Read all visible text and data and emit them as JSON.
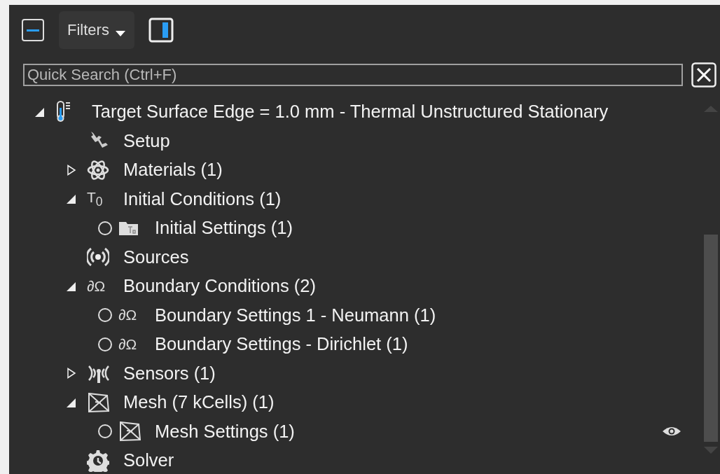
{
  "toolbar": {
    "filters": "Filters"
  },
  "search": {
    "placeholder": "Quick Search (Ctrl+F)"
  },
  "tree": [
    {
      "label": "Target Surface Edge = 1.0 mm - Thermal Unstructured Stationary",
      "kind": "thermometer",
      "expanded": true,
      "children": [
        {
          "label": "Setup",
          "kind": "tool"
        },
        {
          "label": "Materials (1)",
          "kind": "atom",
          "expanded": false
        },
        {
          "label": "Initial Conditions (1)",
          "kind": "glyph",
          "glyph": "T$_{0}$",
          "expanded": true,
          "children": [
            {
              "label": "Initial Settings (1)",
              "kind": "folder",
              "checked": false,
              "eye": false
            }
          ]
        },
        {
          "label": "Sources",
          "kind": "sources"
        },
        {
          "label": "Boundary Conditions (2)",
          "kind": "glyph",
          "glyph": "∂Ω",
          "expanded": true,
          "children": [
            {
              "label": "Boundary Settings 1 - Neumann (1)",
              "kind": "glyph",
              "glyph": "∂Ω",
              "checked": false,
              "eye": false
            },
            {
              "label": "Boundary Settings - Dirichlet (1)",
              "kind": "glyph",
              "glyph": "∂Ω",
              "checked": false,
              "eye": false
            }
          ]
        },
        {
          "label": "Sensors (1)",
          "kind": "sensors",
          "expanded": false
        },
        {
          "label": "Mesh (7 kCells) (1)",
          "kind": "mesh",
          "expanded": true,
          "children": [
            {
              "label": "Mesh Settings (1)",
              "kind": "mesh",
              "checked": false,
              "eye": true
            }
          ]
        },
        {
          "label": "Solver",
          "kind": "solver"
        }
      ]
    }
  ]
}
